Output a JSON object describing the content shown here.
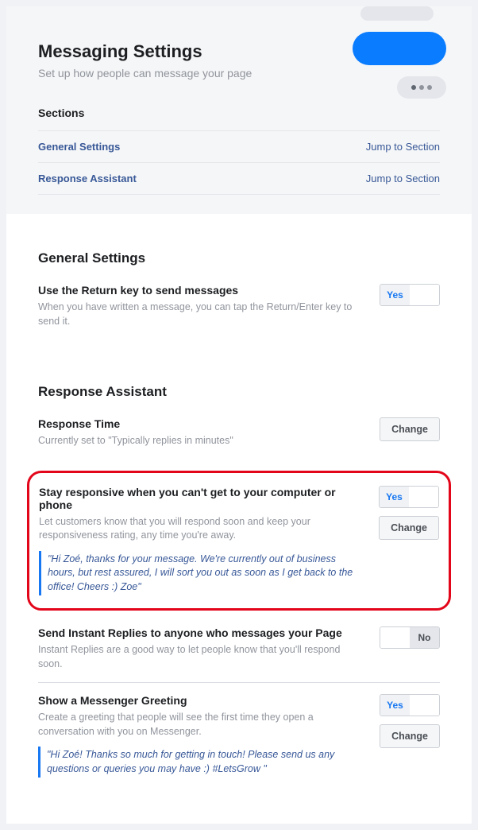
{
  "header": {
    "title": "Messaging Settings",
    "subtitle": "Set up how people can message your page",
    "sections_label": "Sections",
    "jump_label": "Jump to Section",
    "sections": [
      {
        "name": "General Settings"
      },
      {
        "name": "Response Assistant"
      }
    ]
  },
  "toggle": {
    "yes": "Yes",
    "no": "No"
  },
  "change_label": "Change",
  "general": {
    "heading": "General Settings",
    "return_key": {
      "title": "Use the Return key to send messages",
      "desc": "When you have written a message, you can tap the Return/Enter key to send it.",
      "state": "yes"
    }
  },
  "assistant": {
    "heading": "Response Assistant",
    "response_time": {
      "title": "Response Time",
      "desc": "Currently set to \"Typically replies in minutes\""
    },
    "stay_responsive": {
      "title": "Stay responsive when you can't get to your computer or phone",
      "desc": "Let customers know that you will respond soon and keep your responsiveness rating, any time you're away.",
      "state": "yes",
      "quote": "\"Hi Zoé, thanks for your message. We're currently out of business hours, but rest assured, I will sort you out as soon as I get back to the office! Cheers :) Zoe\""
    },
    "instant_replies": {
      "title": "Send Instant Replies to anyone who messages your Page",
      "desc": "Instant Replies are a good way to let people know that you'll respond soon.",
      "state": "no"
    },
    "greeting": {
      "title": "Show a Messenger Greeting",
      "desc": "Create a greeting that people will see the first time they open a conversation with you on Messenger.",
      "state": "yes",
      "quote": "\"Hi Zoé! Thanks so much for getting in touch! Please send us any questions or queries you may have :) #LetsGrow \""
    }
  }
}
